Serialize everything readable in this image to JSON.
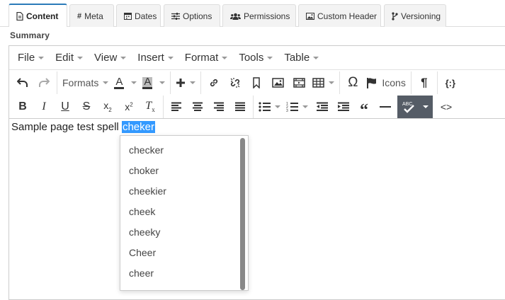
{
  "tabs": [
    {
      "label": "Content",
      "icon": "document-icon",
      "active": true
    },
    {
      "label": "Meta",
      "icon": "hash-icon"
    },
    {
      "label": "Dates",
      "icon": "calendar-icon"
    },
    {
      "label": "Options",
      "icon": "sliders-icon"
    },
    {
      "label": "Permissions",
      "icon": "users-icon"
    },
    {
      "label": "Custom Header",
      "icon": "image-icon"
    },
    {
      "label": "Versioning",
      "icon": "branch-icon"
    }
  ],
  "summary_label": "Summary",
  "menubar": [
    "File",
    "Edit",
    "View",
    "Insert",
    "Format",
    "Tools",
    "Table"
  ],
  "toolbar": {
    "formats_label": "Formats",
    "icons_label": "Icons",
    "text_color_glyph": "A",
    "bg_color_glyph": "A"
  },
  "content": {
    "text_before": "Sample page test spell ",
    "misspelled": "cheker"
  },
  "suggestions": [
    "checker",
    "choker",
    "cheekier",
    "cheek",
    "cheeky",
    "Cheer",
    "cheer"
  ]
}
